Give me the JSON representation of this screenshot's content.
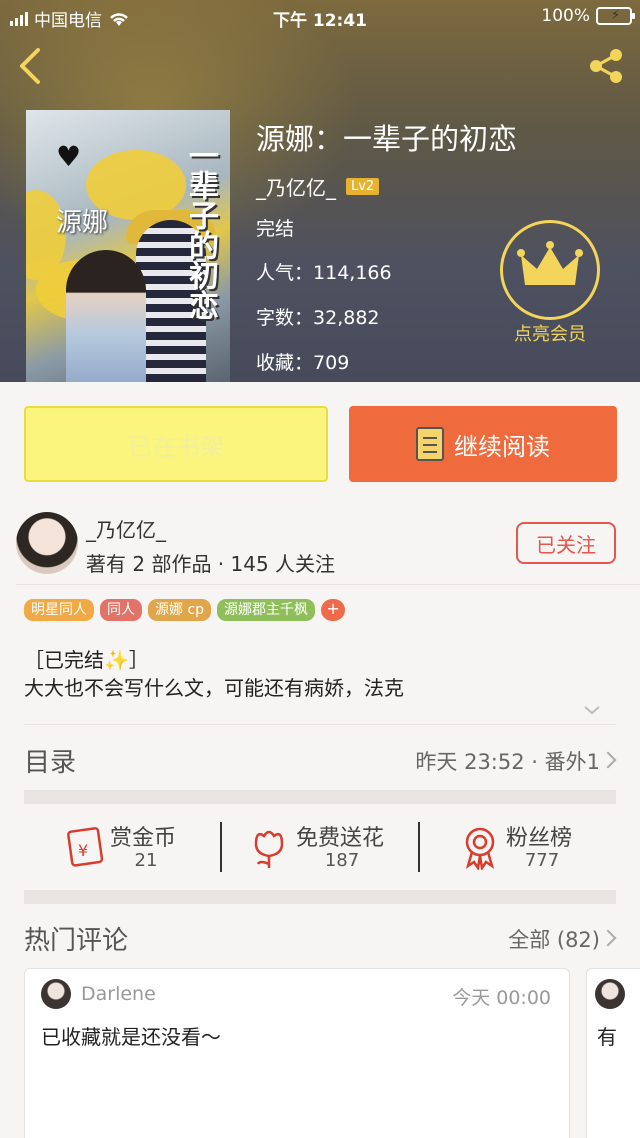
{
  "status_bar": {
    "carrier": "中国电信",
    "time": "下午 12:41",
    "battery": "100%"
  },
  "book": {
    "title": "源娜：一辈子的初恋",
    "author": "_乃亿亿_",
    "level": "Lv2",
    "status": "完结",
    "popularity_label": "人气：",
    "popularity": "114,166",
    "words_label": "字数：",
    "words": "32,882",
    "favorites_label": "收藏：",
    "favorites": "709",
    "cover_name": "源娜",
    "cover_title": "一辈子的初恋"
  },
  "vip": {
    "label": "点亮会员",
    "color": "#f2d55a"
  },
  "actions": {
    "shelf_label": "已在书架",
    "read_label": "继续阅读"
  },
  "author_info": {
    "name": "_乃亿亿_",
    "stats": "著有 2 部作品 · 145 人关注",
    "follow_label": "已关注"
  },
  "tags": [
    {
      "label": "明星同人",
      "color": "#f0a945"
    },
    {
      "label": "同人",
      "color": "#e07468"
    },
    {
      "label": "源娜 cp",
      "color": "#e2a64a"
    },
    {
      "label": "源娜郡主千枫",
      "color": "#8fbf5a"
    }
  ],
  "description": {
    "line1": "［已完结✨］",
    "line2": "大大也不会写什么文，可能还有病娇，法克"
  },
  "toc": {
    "title": "目录",
    "latest": "昨天 23:52 · 番外1"
  },
  "stats": [
    {
      "label": "赏金币",
      "value": "21",
      "icon": "red-envelope-icon"
    },
    {
      "label": "免费送花",
      "value": "187",
      "icon": "flower-icon"
    },
    {
      "label": "粉丝榜",
      "value": "777",
      "icon": "medal-icon"
    }
  ],
  "comments": {
    "title": "热门评论",
    "all_label": "全部 (82)",
    "items": [
      {
        "user": "Darlene",
        "time": "今天 00:00",
        "text": "已收藏就是还没看～"
      },
      {
        "user": "",
        "time": "",
        "text": "有"
      }
    ]
  },
  "colors": {
    "accent": "#ef6a3c",
    "shelf": "#fbf57d",
    "follow": "#e5574d"
  }
}
